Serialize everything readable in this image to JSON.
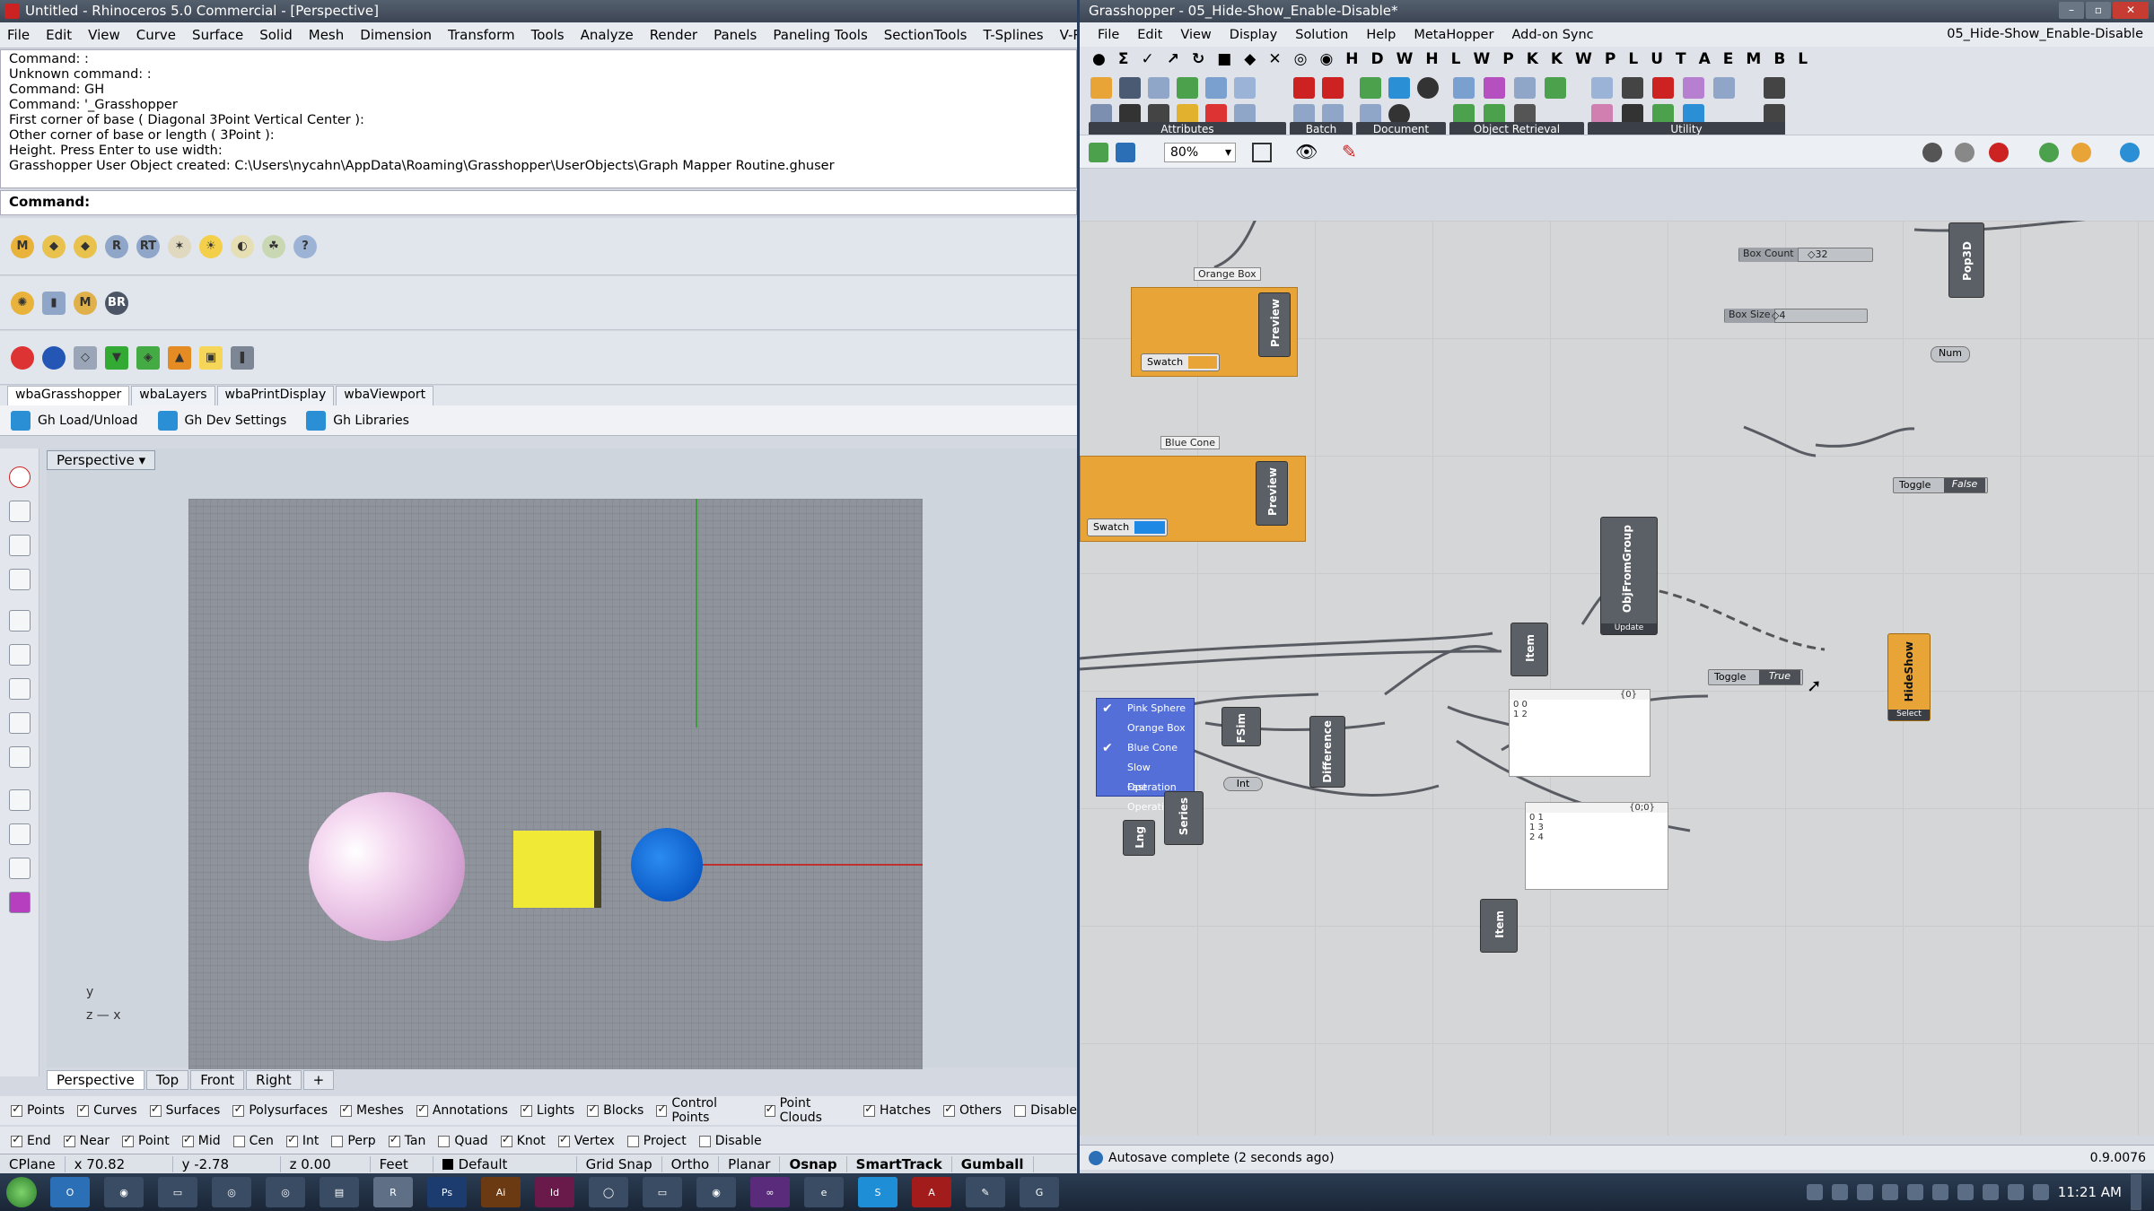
{
  "rhino": {
    "title": "Untitled - Rhinoceros 5.0 Commercial - [Perspective]",
    "menu": [
      "File",
      "Edit",
      "View",
      "Curve",
      "Surface",
      "Solid",
      "Mesh",
      "Dimension",
      "Transform",
      "Tools",
      "Analyze",
      "Render",
      "Panels",
      "Paneling Tools",
      "SectionTools",
      "T-Splines",
      "V-Ray",
      "Help"
    ],
    "history": [
      "Command: :",
      "Unknown command: :",
      "Command: GH",
      "Command: '_Grasshopper",
      "First corner of base ( Diagonal  3Point  Vertical  Center ):",
      "Other corner of base or length ( 3Point ):",
      "Height. Press Enter to use width:",
      "Grasshopper User Object created: C:\\Users\\nycahn\\AppData\\Roaming\\Grasshopper\\UserObjects\\Graph Mapper Routine.ghuser"
    ],
    "command_label": "Command:",
    "tabs": [
      "wbaGrasshopper",
      "wbaLayers",
      "wbaPrintDisplay",
      "wbaViewport"
    ],
    "tab_buttons": [
      "Gh Load/Unload",
      "Gh Dev Settings",
      "Gh Libraries"
    ],
    "viewport_name": "Perspective",
    "axis_y": "y",
    "axis_z": "z",
    "axis_x": "x",
    "view_tabs": [
      "Perspective",
      "Top",
      "Front",
      "Right"
    ],
    "filters": [
      {
        "label": "Points",
        "on": true
      },
      {
        "label": "Curves",
        "on": true
      },
      {
        "label": "Surfaces",
        "on": true
      },
      {
        "label": "Polysurfaces",
        "on": true
      },
      {
        "label": "Meshes",
        "on": true
      },
      {
        "label": "Annotations",
        "on": true
      },
      {
        "label": "Lights",
        "on": true
      },
      {
        "label": "Blocks",
        "on": true
      },
      {
        "label": "Control Points",
        "on": true
      },
      {
        "label": "Point Clouds",
        "on": true
      },
      {
        "label": "Hatches",
        "on": true
      },
      {
        "label": "Others",
        "on": true
      },
      {
        "label": "Disable",
        "on": false
      }
    ],
    "osnaps": [
      {
        "label": "End",
        "on": true
      },
      {
        "label": "Near",
        "on": true
      },
      {
        "label": "Point",
        "on": true
      },
      {
        "label": "Mid",
        "on": true
      },
      {
        "label": "Cen",
        "on": false
      },
      {
        "label": "Int",
        "on": true
      },
      {
        "label": "Perp",
        "on": false
      },
      {
        "label": "Tan",
        "on": true
      },
      {
        "label": "Quad",
        "on": false
      },
      {
        "label": "Knot",
        "on": true
      },
      {
        "label": "Vertex",
        "on": true
      },
      {
        "label": "Project",
        "on": false
      },
      {
        "label": "Disable",
        "on": false
      }
    ],
    "status": {
      "cplane": "CPlane",
      "x": "x 70.82",
      "y": "y -2.78",
      "z": "z 0.00",
      "units": "Feet",
      "layer": "Default",
      "grid_snap": "Grid Snap",
      "ortho": "Ortho",
      "planar": "Planar",
      "osnap": "Osnap",
      "smarttrack": "SmartTrack",
      "gumball": "Gumball"
    }
  },
  "gh": {
    "title": "Grasshopper - 05_Hide-Show_Enable-Disable*",
    "doc_name": "05_Hide-Show_Enable-Disable",
    "menu": [
      "File",
      "Edit",
      "View",
      "Display",
      "Solution",
      "Help",
      "MetaHopper",
      "Add-on Sync"
    ],
    "tab_letters": [
      "H",
      "D",
      "W",
      "H",
      "L",
      "W",
      "P",
      "K",
      "K",
      "W",
      "P",
      "L",
      "U",
      "T",
      "A",
      "E",
      "M",
      "B",
      "L"
    ],
    "panel_labels": [
      "Attributes",
      "Batch",
      "Document",
      "Object Retrieval",
      "Utility"
    ],
    "zoom": "80%",
    "nodes": {
      "orange_box": "Orange Box",
      "blue_cone": "Blue Cone",
      "preview": "Preview",
      "swatch": "Swatch",
      "box_count": "Box Count",
      "box_count_val": "◇32",
      "box_size": "Box Size",
      "box_size_val": "◇4",
      "pop3d": "Pop3D",
      "num": "Num",
      "toggle": "Toggle",
      "toggle_false": "False",
      "toggle_true": "True",
      "objfromgroup": "ObjFromGroup",
      "update": "Update",
      "item": "Item",
      "fsim": "FSim",
      "difference": "Difference",
      "int": "Int",
      "series": "Series",
      "lng": "Lng",
      "hideshow": "HideShow",
      "select": "Select",
      "panel1_header": "{0}",
      "panel1_rows": [
        "0 0",
        "1 2"
      ],
      "panel2_header": "{0;0}",
      "panel2_rows": [
        "0 1",
        "1 3",
        "2 4"
      ],
      "list_items": [
        {
          "label": "Pink Sphere",
          "checked": true
        },
        {
          "label": "Orange Box",
          "checked": false
        },
        {
          "label": "Blue Cone",
          "checked": true
        },
        {
          "label": "Slow Operation",
          "checked": false
        },
        {
          "label": "Fast Operation",
          "checked": false
        }
      ]
    },
    "status_text": "Autosave complete (2 seconds ago)",
    "version": "0.9.0076"
  },
  "taskbar": {
    "clock": "11:21 AM"
  }
}
